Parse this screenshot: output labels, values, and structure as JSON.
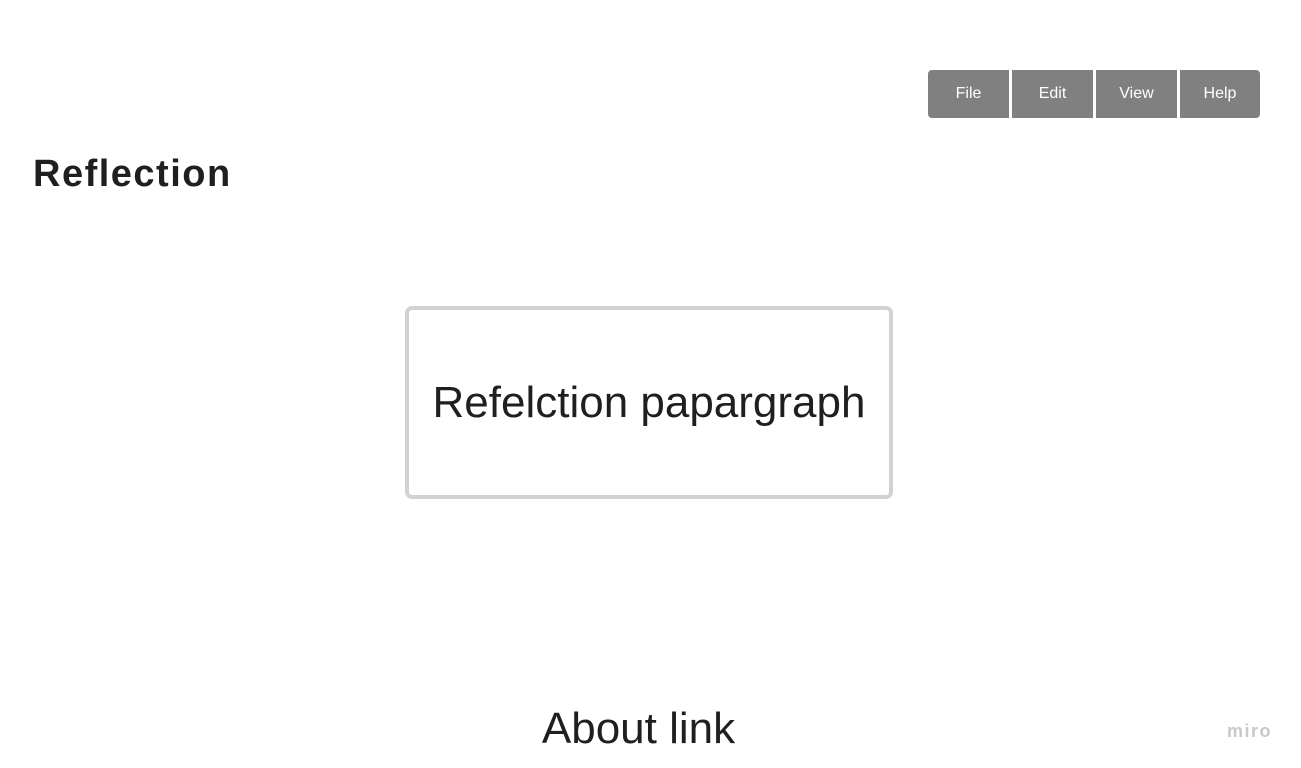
{
  "menu": {
    "items": [
      {
        "label": "File"
      },
      {
        "label": "Edit"
      },
      {
        "label": "View"
      },
      {
        "label": "Help"
      }
    ]
  },
  "page": {
    "title": "Reflection",
    "paragraph_placeholder": "Refelction papargraph",
    "about_link": "About link"
  },
  "watermark": {
    "text": "miro"
  },
  "colors": {
    "menu_bg": "#808080",
    "menu_text": "#ffffff",
    "box_border": "#d2d2d2",
    "text": "#1f1f1f",
    "watermark": "#c8c8c8"
  }
}
